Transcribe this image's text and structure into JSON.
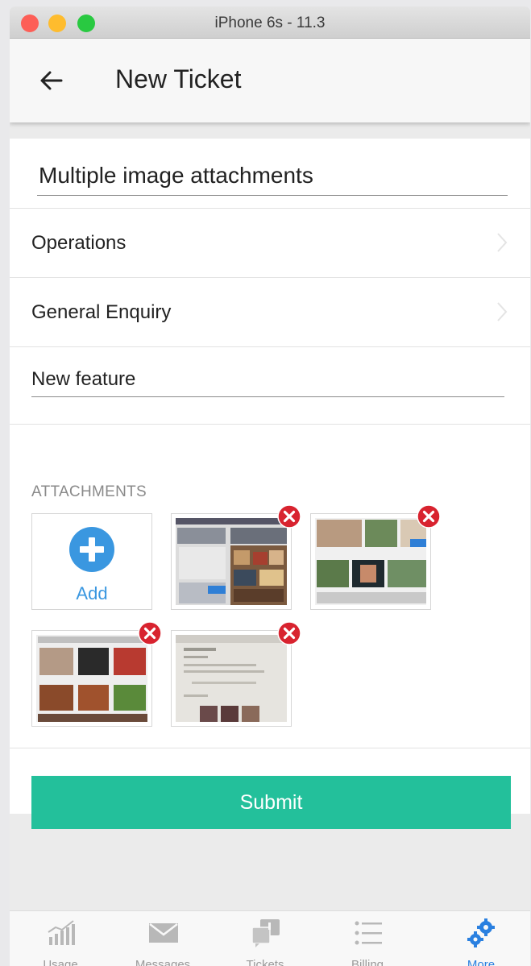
{
  "simulator": {
    "title": "iPhone 6s - 11.3"
  },
  "header": {
    "title": "New Ticket"
  },
  "form": {
    "title_value": "Multiple image attachments",
    "department": "Operations",
    "category": "General Enquiry",
    "subcategory_value": "New feature",
    "attachments_label": "ATTACHMENTS",
    "add_label": "Add",
    "submit_label": "Submit"
  },
  "tabs": [
    {
      "label": "Usage",
      "icon": "bar-chart-icon"
    },
    {
      "label": "Messages",
      "icon": "envelope-icon"
    },
    {
      "label": "Tickets",
      "icon": "tickets-icon"
    },
    {
      "label": "Billing",
      "icon": "list-icon"
    },
    {
      "label": "More",
      "icon": "gears-icon",
      "active": true
    }
  ],
  "colors": {
    "accent": "#23c09b",
    "add_blue": "#3a97e0",
    "remove_red": "#d8232f",
    "active_tab": "#2a80e0"
  }
}
